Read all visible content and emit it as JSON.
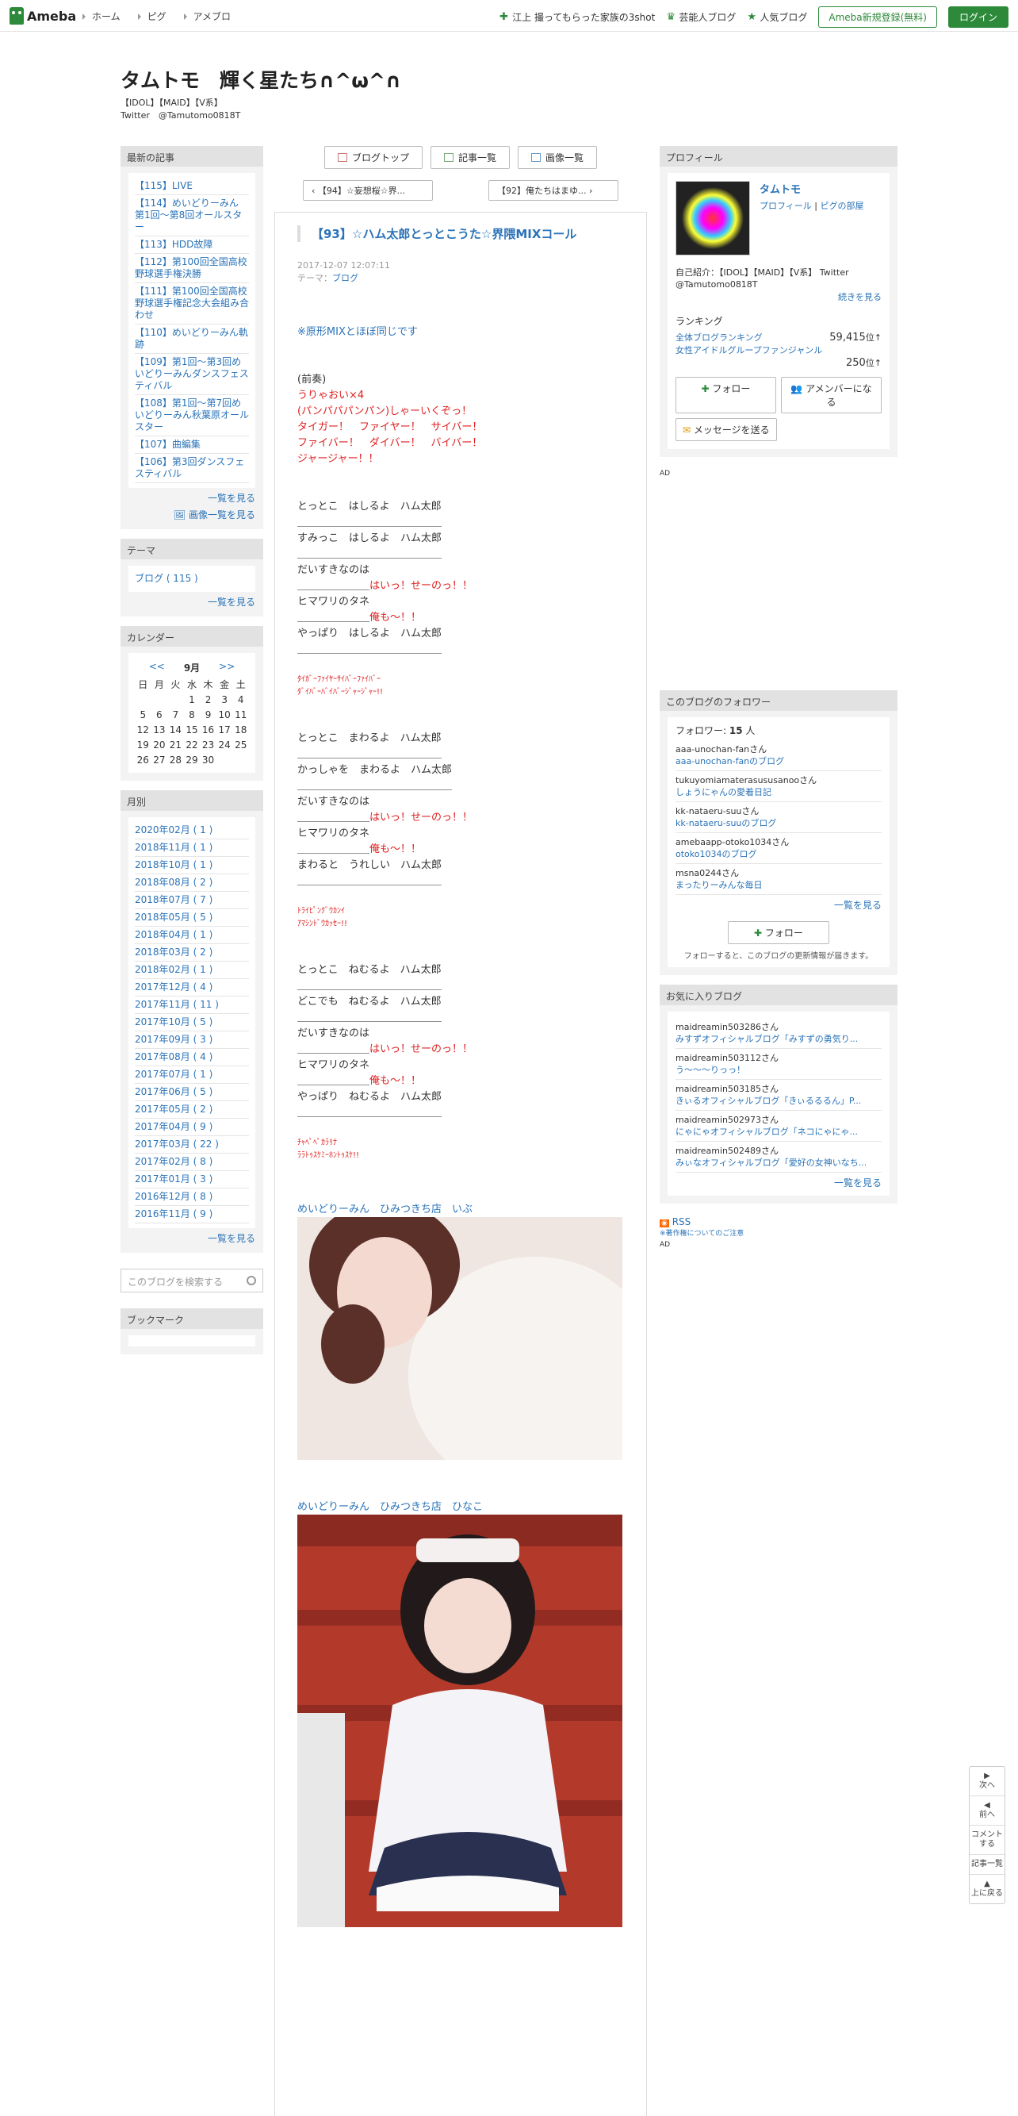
{
  "topbar": {
    "logo": "Ameba",
    "nav": [
      "ホーム",
      "ピグ",
      "アメブロ"
    ],
    "featured": "江上 撮ってもらった家族の3shot",
    "celeb": "芸能人ブログ",
    "popular": "人気ブログ",
    "register": "Ameba新規登録(無料)",
    "login": "ログイン"
  },
  "blog": {
    "title": "タムトモ　輝く星たち∩^ω^∩",
    "desc1": "【IDOL】【MAID】【V系】",
    "desc2": "Twitter　@Tamutomo0818T"
  },
  "left": {
    "recent_header": "最新の記事",
    "recent": [
      "【115】LIVE",
      "【114】めいどりーみん　第1回～第8回オールスター",
      "【113】HDD故障",
      "【112】第100回全国高校野球選手権決勝",
      "【111】第100回全国高校野球選手権記念大会組み合わせ",
      "【110】めいどりーみん軌跡",
      "【109】第1回～第3回めいどりーみんダンスフェスティバル",
      "【108】第1回～第7回めいどりーみん秋葉原オールスター",
      "【107】曲編集",
      "【106】第3回ダンスフェスティバル"
    ],
    "recent_more": "一覧を見る",
    "image_more": "画像一覧を見る",
    "theme_header": "テーマ",
    "theme_item": "ブログ ( 115 )",
    "theme_more": "一覧を見る",
    "calendar_header": "カレンダー",
    "cal_prev": "<<",
    "cal_month": "9月",
    "cal_next": ">>",
    "cal_days": [
      "日",
      "月",
      "火",
      "水",
      "木",
      "金",
      "土",
      "",
      "",
      "",
      "1",
      "2",
      "3",
      "4",
      "5",
      "6",
      "7",
      "8",
      "9",
      "10",
      "11",
      "12",
      "13",
      "14",
      "15",
      "16",
      "17",
      "18",
      "19",
      "20",
      "21",
      "22",
      "23",
      "24",
      "25",
      "26",
      "27",
      "28",
      "29",
      "30",
      "",
      ""
    ],
    "monthly_header": "月別",
    "monthly": [
      "2020年02月 ( 1 )",
      "2018年11月 ( 1 )",
      "2018年10月 ( 1 )",
      "2018年08月 ( 2 )",
      "2018年07月 ( 7 )",
      "2018年05月 ( 5 )",
      "2018年04月 ( 1 )",
      "2018年03月 ( 2 )",
      "2018年02月 ( 1 )",
      "2017年12月 ( 4 )",
      "2017年11月 ( 11 )",
      "2017年10月 ( 5 )",
      "2017年09月 ( 3 )",
      "2017年08月 ( 4 )",
      "2017年07月 ( 1 )",
      "2017年06月 ( 5 )",
      "2017年05月 ( 2 )",
      "2017年04月 ( 9 )",
      "2017年03月 ( 22 )",
      "2017年02月 ( 8 )",
      "2017年01月 ( 3 )",
      "2016年12月 ( 8 )",
      "2016年11月 ( 9 )"
    ],
    "monthly_more": "一覧を見る",
    "search_placeholder": "このブログを検索する",
    "bookmark_header": "ブックマーク"
  },
  "center": {
    "btn_top": "ブログトップ",
    "btn_list": "記事一覧",
    "btn_images": "画像一覧",
    "prev": "【94】☆妄想桜☆界...",
    "next": "【92】俺たちはまゆ...",
    "title": "【93】☆ハム太郎とっとこうた☆界隈MIXコール",
    "date": "2017-12-07 12:07:11",
    "theme_label": "テーマ：",
    "theme_value": "ブログ",
    "lines": [
      {
        "t": "※原形MIXとほぼ同じです",
        "c": "blue"
      },
      {
        "t": "",
        "c": ""
      },
      {
        "t": "",
        "c": ""
      },
      {
        "t": "(前奏)",
        "c": ""
      },
      {
        "t": "うりゃおい×4",
        "c": "red"
      },
      {
        "t": "(パンパパパンパン)しゃーいくぞっ！",
        "c": "red"
      },
      {
        "t": "タイガー！　ファイヤー！　サイバー！",
        "c": "red"
      },
      {
        "t": "ファイバー！　ダイバー！　バイバー！",
        "c": "red"
      },
      {
        "t": "ジャージャー！！",
        "c": "red"
      },
      {
        "t": "",
        "c": ""
      },
      {
        "t": "",
        "c": ""
      },
      {
        "t": "とっとこ　はしるよ　ハム太郎",
        "c": ""
      },
      {
        "t": "＿＿＿＿＿＿＿＿＿＿＿＿＿＿",
        "c": ""
      },
      {
        "t": "すみっこ　はしるよ　ハム太郎",
        "c": ""
      },
      {
        "t": "＿＿＿＿＿＿＿＿＿＿＿＿＿＿",
        "c": ""
      },
      {
        "t": "だいすきなのは",
        "c": ""
      },
      {
        "t": "＿＿＿＿＿＿＿はいっ！せーのっ！！",
        "c": "mix1"
      },
      {
        "t": "ヒマワリのタネ",
        "c": ""
      },
      {
        "t": "＿＿＿＿＿＿＿俺も～！！",
        "c": "mix1"
      },
      {
        "t": "やっぱり　はしるよ　ハム太郎",
        "c": ""
      },
      {
        "t": "＿＿＿＿＿＿＿＿＿＿＿＿＿＿",
        "c": ""
      },
      {
        "t": "",
        "c": ""
      },
      {
        "t": "ﾀｲｶﾞｰﾌｧｲﾔｰｻｲﾊﾞｰﾌｧｲﾊﾞｰ",
        "c": "small"
      },
      {
        "t": "ﾀﾞｲﾊﾞｰﾊﾞｲﾊﾞｰｼﾞｬｰｼﾞｬｰ!!",
        "c": "small"
      },
      {
        "t": "",
        "c": ""
      },
      {
        "t": "",
        "c": ""
      },
      {
        "t": "とっとこ　まわるよ　ハム太郎",
        "c": ""
      },
      {
        "t": "＿＿＿＿＿＿＿＿＿＿＿＿＿＿",
        "c": ""
      },
      {
        "t": "かっしゃを　まわるよ　ハム太郎",
        "c": ""
      },
      {
        "t": "＿＿＿＿＿＿＿＿＿＿＿＿＿＿＿",
        "c": ""
      },
      {
        "t": "だいすきなのは",
        "c": ""
      },
      {
        "t": "＿＿＿＿＿＿＿はいっ！せーのっ！！",
        "c": "mix1"
      },
      {
        "t": "ヒマワリのタネ",
        "c": ""
      },
      {
        "t": "＿＿＿＿＿＿＿俺も～！！",
        "c": "mix1"
      },
      {
        "t": "まわると　うれしい　ハム太郎",
        "c": ""
      },
      {
        "t": "＿＿＿＿＿＿＿＿＿＿＿＿＿＿",
        "c": ""
      },
      {
        "t": "",
        "c": ""
      },
      {
        "t": "ﾄﾗｲﾋﾟﾝｸﾞｳｶﾝｲ",
        "c": "small"
      },
      {
        "t": "ｱﾏｼﾝﾄﾞｳｶｯｾｰ!!",
        "c": "small"
      },
      {
        "t": "",
        "c": ""
      },
      {
        "t": "",
        "c": ""
      },
      {
        "t": "とっとこ　ねむるよ　ハム太郎",
        "c": ""
      },
      {
        "t": "＿＿＿＿＿＿＿＿＿＿＿＿＿＿",
        "c": ""
      },
      {
        "t": "どこでも　ねむるよ　ハム太郎",
        "c": ""
      },
      {
        "t": "＿＿＿＿＿＿＿＿＿＿＿＿＿＿",
        "c": ""
      },
      {
        "t": "だいすきなのは",
        "c": ""
      },
      {
        "t": "＿＿＿＿＿＿＿はいっ！せーのっ！！",
        "c": "mix1"
      },
      {
        "t": "ヒマワリのタネ",
        "c": ""
      },
      {
        "t": "＿＿＿＿＿＿＿俺も～！！",
        "c": "mix1"
      },
      {
        "t": "やっぱり　ねむるよ　ハム太郎",
        "c": ""
      },
      {
        "t": "＿＿＿＿＿＿＿＿＿＿＿＿＿＿",
        "c": ""
      },
      {
        "t": "",
        "c": ""
      },
      {
        "t": "ﾁｬﾍﾟﾍﾟｶﾗﾘﾅ",
        "c": "small"
      },
      {
        "t": "ﾗﾗﾄｩｽｹﾐｰﾎﾝﾄｩｽｹ!!",
        "c": "small"
      }
    ],
    "photo1_caption": "めいどりーみん　ひみつきち店　いぶ",
    "photo2_caption": "めいどりーみん　ひみつきち店　ひなこ"
  },
  "right": {
    "profile_header": "プロフィール",
    "name": "タムトモ",
    "profile_link": "プロフィール",
    "pigg_link": "ピグの部屋",
    "intro": "自己紹介：【IDOL】【MAID】【V系】 Twitter @Tamutomo0818T",
    "intro_more": "続きを見る",
    "ranking_label": "ランキング",
    "rank1_label": "全体ブログランキング",
    "rank1_value": "59,415",
    "rank2_label": "女性アイドルグループファンジャンル",
    "rank2_value": "250",
    "rank_unit": "位",
    "follow_btn": "フォロー",
    "member_btn": "アメンバーになる",
    "message_btn": "メッセージを送る",
    "ad1": "AD",
    "followers_header": "このブログのフォロワー",
    "followers_label": "フォロワー:",
    "followers_count": "15",
    "followers_unit": "人",
    "followers": [
      {
        "user": "aaa-unochan-fanさん",
        "blog": "aaa-unochan-fanのブログ"
      },
      {
        "user": "tukuyomiamaterasususanooさん",
        "blog": "しょうにゃんの愛着日記"
      },
      {
        "user": "kk-nataeru-suuさん",
        "blog": "kk-nataeru-suuのブログ"
      },
      {
        "user": "amebaapp-otoko1034さん",
        "blog": "otoko1034のブログ"
      },
      {
        "user": "msna0244さん",
        "blog": "まったりーみんな毎日"
      }
    ],
    "followers_more": "一覧を見る",
    "follow_btn2": "フォロー",
    "follow_note": "フォローすると、このブログの更新情報が届きます。",
    "fav_header": "お気に入りブログ",
    "favs": [
      {
        "user": "maidreamin503286さん",
        "blog": "みすずオフィシャルブログ「みすずの勇気り..."
      },
      {
        "user": "maidreamin503112さん",
        "blog": "う〜〜〜りっっ！"
      },
      {
        "user": "maidreamin503185さん",
        "blog": "きぃるオフィシャルブログ「きぃるるるん」P..."
      },
      {
        "user": "maidreamin502973さん",
        "blog": "にゃにゃオフィシャルブログ「ネコにゃにゃ..."
      },
      {
        "user": "maidreamin502489さん",
        "blog": "みぃなオフィシャルブログ「愛好の女神いなち..."
      }
    ],
    "fav_more": "一覧を見る",
    "rss": "RSS",
    "copyright": "※著作権についてのご注意",
    "ad2": "AD"
  },
  "sidenav": [
    "次へ",
    "前へ",
    "コメントする",
    "記事一覧",
    "上に戻る"
  ]
}
